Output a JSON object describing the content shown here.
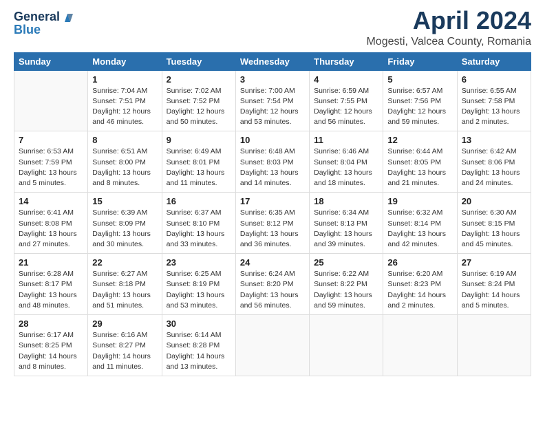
{
  "logo": {
    "general": "General",
    "blue": "Blue"
  },
  "title": "April 2024",
  "subtitle": "Mogesti, Valcea County, Romania",
  "days_of_week": [
    "Sunday",
    "Monday",
    "Tuesday",
    "Wednesday",
    "Thursday",
    "Friday",
    "Saturday"
  ],
  "weeks": [
    [
      {
        "day": "",
        "sunrise": "",
        "sunset": "",
        "daylight": ""
      },
      {
        "day": "1",
        "sunrise": "Sunrise: 7:04 AM",
        "sunset": "Sunset: 7:51 PM",
        "daylight": "Daylight: 12 hours and 46 minutes."
      },
      {
        "day": "2",
        "sunrise": "Sunrise: 7:02 AM",
        "sunset": "Sunset: 7:52 PM",
        "daylight": "Daylight: 12 hours and 50 minutes."
      },
      {
        "day": "3",
        "sunrise": "Sunrise: 7:00 AM",
        "sunset": "Sunset: 7:54 PM",
        "daylight": "Daylight: 12 hours and 53 minutes."
      },
      {
        "day": "4",
        "sunrise": "Sunrise: 6:59 AM",
        "sunset": "Sunset: 7:55 PM",
        "daylight": "Daylight: 12 hours and 56 minutes."
      },
      {
        "day": "5",
        "sunrise": "Sunrise: 6:57 AM",
        "sunset": "Sunset: 7:56 PM",
        "daylight": "Daylight: 12 hours and 59 minutes."
      },
      {
        "day": "6",
        "sunrise": "Sunrise: 6:55 AM",
        "sunset": "Sunset: 7:58 PM",
        "daylight": "Daylight: 13 hours and 2 minutes."
      }
    ],
    [
      {
        "day": "7",
        "sunrise": "Sunrise: 6:53 AM",
        "sunset": "Sunset: 7:59 PM",
        "daylight": "Daylight: 13 hours and 5 minutes."
      },
      {
        "day": "8",
        "sunrise": "Sunrise: 6:51 AM",
        "sunset": "Sunset: 8:00 PM",
        "daylight": "Daylight: 13 hours and 8 minutes."
      },
      {
        "day": "9",
        "sunrise": "Sunrise: 6:49 AM",
        "sunset": "Sunset: 8:01 PM",
        "daylight": "Daylight: 13 hours and 11 minutes."
      },
      {
        "day": "10",
        "sunrise": "Sunrise: 6:48 AM",
        "sunset": "Sunset: 8:03 PM",
        "daylight": "Daylight: 13 hours and 14 minutes."
      },
      {
        "day": "11",
        "sunrise": "Sunrise: 6:46 AM",
        "sunset": "Sunset: 8:04 PM",
        "daylight": "Daylight: 13 hours and 18 minutes."
      },
      {
        "day": "12",
        "sunrise": "Sunrise: 6:44 AM",
        "sunset": "Sunset: 8:05 PM",
        "daylight": "Daylight: 13 hours and 21 minutes."
      },
      {
        "day": "13",
        "sunrise": "Sunrise: 6:42 AM",
        "sunset": "Sunset: 8:06 PM",
        "daylight": "Daylight: 13 hours and 24 minutes."
      }
    ],
    [
      {
        "day": "14",
        "sunrise": "Sunrise: 6:41 AM",
        "sunset": "Sunset: 8:08 PM",
        "daylight": "Daylight: 13 hours and 27 minutes."
      },
      {
        "day": "15",
        "sunrise": "Sunrise: 6:39 AM",
        "sunset": "Sunset: 8:09 PM",
        "daylight": "Daylight: 13 hours and 30 minutes."
      },
      {
        "day": "16",
        "sunrise": "Sunrise: 6:37 AM",
        "sunset": "Sunset: 8:10 PM",
        "daylight": "Daylight: 13 hours and 33 minutes."
      },
      {
        "day": "17",
        "sunrise": "Sunrise: 6:35 AM",
        "sunset": "Sunset: 8:12 PM",
        "daylight": "Daylight: 13 hours and 36 minutes."
      },
      {
        "day": "18",
        "sunrise": "Sunrise: 6:34 AM",
        "sunset": "Sunset: 8:13 PM",
        "daylight": "Daylight: 13 hours and 39 minutes."
      },
      {
        "day": "19",
        "sunrise": "Sunrise: 6:32 AM",
        "sunset": "Sunset: 8:14 PM",
        "daylight": "Daylight: 13 hours and 42 minutes."
      },
      {
        "day": "20",
        "sunrise": "Sunrise: 6:30 AM",
        "sunset": "Sunset: 8:15 PM",
        "daylight": "Daylight: 13 hours and 45 minutes."
      }
    ],
    [
      {
        "day": "21",
        "sunrise": "Sunrise: 6:28 AM",
        "sunset": "Sunset: 8:17 PM",
        "daylight": "Daylight: 13 hours and 48 minutes."
      },
      {
        "day": "22",
        "sunrise": "Sunrise: 6:27 AM",
        "sunset": "Sunset: 8:18 PM",
        "daylight": "Daylight: 13 hours and 51 minutes."
      },
      {
        "day": "23",
        "sunrise": "Sunrise: 6:25 AM",
        "sunset": "Sunset: 8:19 PM",
        "daylight": "Daylight: 13 hours and 53 minutes."
      },
      {
        "day": "24",
        "sunrise": "Sunrise: 6:24 AM",
        "sunset": "Sunset: 8:20 PM",
        "daylight": "Daylight: 13 hours and 56 minutes."
      },
      {
        "day": "25",
        "sunrise": "Sunrise: 6:22 AM",
        "sunset": "Sunset: 8:22 PM",
        "daylight": "Daylight: 13 hours and 59 minutes."
      },
      {
        "day": "26",
        "sunrise": "Sunrise: 6:20 AM",
        "sunset": "Sunset: 8:23 PM",
        "daylight": "Daylight: 14 hours and 2 minutes."
      },
      {
        "day": "27",
        "sunrise": "Sunrise: 6:19 AM",
        "sunset": "Sunset: 8:24 PM",
        "daylight": "Daylight: 14 hours and 5 minutes."
      }
    ],
    [
      {
        "day": "28",
        "sunrise": "Sunrise: 6:17 AM",
        "sunset": "Sunset: 8:25 PM",
        "daylight": "Daylight: 14 hours and 8 minutes."
      },
      {
        "day": "29",
        "sunrise": "Sunrise: 6:16 AM",
        "sunset": "Sunset: 8:27 PM",
        "daylight": "Daylight: 14 hours and 11 minutes."
      },
      {
        "day": "30",
        "sunrise": "Sunrise: 6:14 AM",
        "sunset": "Sunset: 8:28 PM",
        "daylight": "Daylight: 14 hours and 13 minutes."
      },
      {
        "day": "",
        "sunrise": "",
        "sunset": "",
        "daylight": ""
      },
      {
        "day": "",
        "sunrise": "",
        "sunset": "",
        "daylight": ""
      },
      {
        "day": "",
        "sunrise": "",
        "sunset": "",
        "daylight": ""
      },
      {
        "day": "",
        "sunrise": "",
        "sunset": "",
        "daylight": ""
      }
    ]
  ]
}
